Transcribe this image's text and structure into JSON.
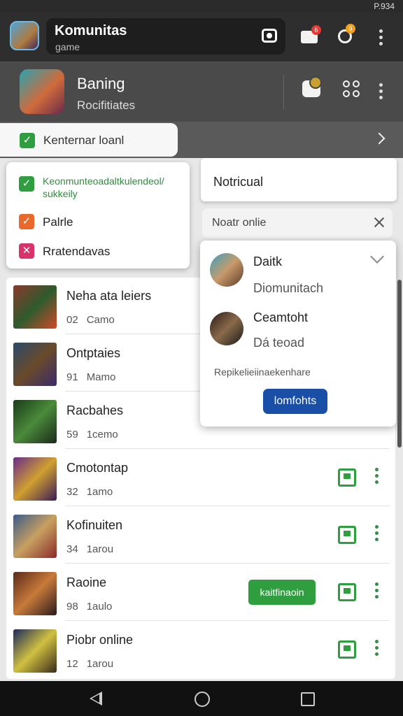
{
  "statusbar": {
    "text": "P.934"
  },
  "appbar": {
    "title": "Komunitas",
    "subtitle": "game",
    "mail_badge": "6",
    "person_badge": "9"
  },
  "game": {
    "title": "Baning",
    "subtitle": "Rocifitiates"
  },
  "filter": {
    "chip_label": "Kenternar loanl"
  },
  "filter_menu": {
    "items": [
      {
        "label": "Keonmunteoadaltkulendeol/ sukkeily",
        "color": "green"
      },
      {
        "label": "Palrle",
        "color": "orange"
      },
      {
        "label": "Rratendavas",
        "color": "pink"
      }
    ]
  },
  "notifications": {
    "title": "Notricual",
    "search_placeholder": "Noatr onlie"
  },
  "popover": {
    "user1": {
      "name": "Daitk",
      "sub": "Diomunitach"
    },
    "user2": {
      "name": "Ceamtoht",
      "sub": "Dá teoad"
    },
    "text": "Repikelieiinaekenhare",
    "button": "lomfohts"
  },
  "list": {
    "rows": [
      {
        "title": "Neha ata leiers",
        "count": "02",
        "unit": "Camo"
      },
      {
        "title": "Ontptaies",
        "count": "91",
        "unit": "Mamo"
      },
      {
        "title": "Racbahes",
        "count": "59",
        "unit": "1cemo"
      },
      {
        "title": "Cmotontap",
        "count": "32",
        "unit": "1amo"
      },
      {
        "title": "Kofinuiten",
        "count": "34",
        "unit": "1arou"
      },
      {
        "title": "Raoine",
        "count": "98",
        "unit": "1aulo",
        "button": "kaitfinaoin"
      },
      {
        "title": "Piobr online",
        "count": "12",
        "unit": "1arou"
      }
    ]
  },
  "colors": {
    "green": "#2e9e3e",
    "blue": "#1a4fa8",
    "orange": "#e8692b",
    "pink": "#d8336a"
  }
}
